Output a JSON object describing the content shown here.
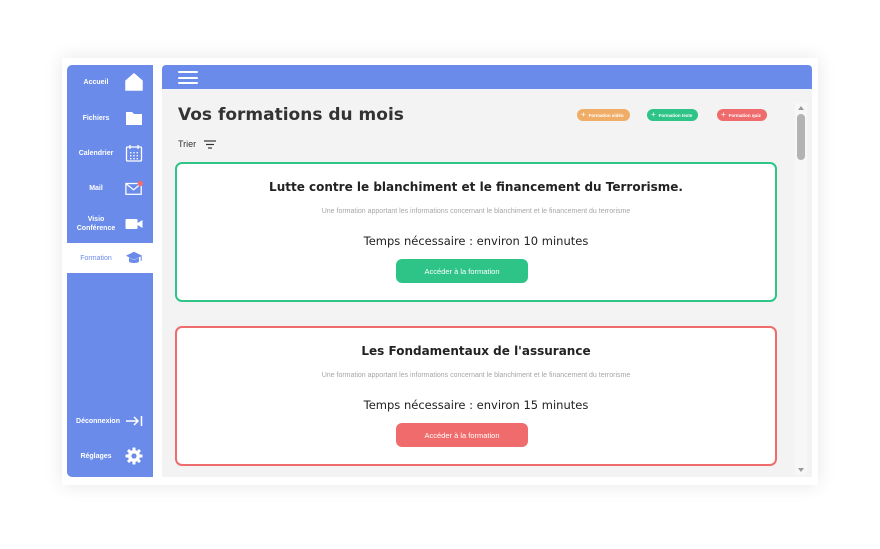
{
  "sidebar": {
    "items": [
      {
        "label": "Accueil",
        "icon": "home-icon"
      },
      {
        "label": "Fichiers",
        "icon": "folder-icon"
      },
      {
        "label": "Calendrier",
        "icon": "calendar-icon"
      },
      {
        "label": "Mail",
        "icon": "mail-icon"
      },
      {
        "label": "Visio Conférence",
        "icon": "video-camera-icon"
      },
      {
        "label": "Formation",
        "icon": "graduation-cap-icon",
        "active": true
      }
    ],
    "bottom": [
      {
        "label": "Déconnexion",
        "icon": "logout-icon"
      },
      {
        "label": "Réglages",
        "icon": "gear-icon"
      }
    ]
  },
  "main": {
    "title": "Vos formations du mois",
    "filters": [
      {
        "label": "Formation vidéo",
        "color": "#f0ad67"
      },
      {
        "label": "Formation texte",
        "color": "#2ec487"
      },
      {
        "label": "Formation quiz",
        "color": "#f06c6c"
      }
    ],
    "sort_label": "Trier",
    "cards": [
      {
        "title": "Lutte contre le blanchiment et le financement du Terrorisme.",
        "description": "Une formation apportant les informations concernant le blanchiment et le financement du terrorisme",
        "time": "Temps nécessaire : environ 10 minutes",
        "button": "Accéder à la formation",
        "color": "#2ec487"
      },
      {
        "title": "Les Fondamentaux de l'assurance",
        "description": "Une formation apportant les informations concernant le blanchiment et le financement du terrorisme",
        "time": "Temps nécessaire : environ 15 minutes",
        "button": "Accéder à la formation",
        "color": "#f06c6c"
      }
    ]
  },
  "colors": {
    "accent": "#6b8bea",
    "notification": "#f06c6c"
  }
}
